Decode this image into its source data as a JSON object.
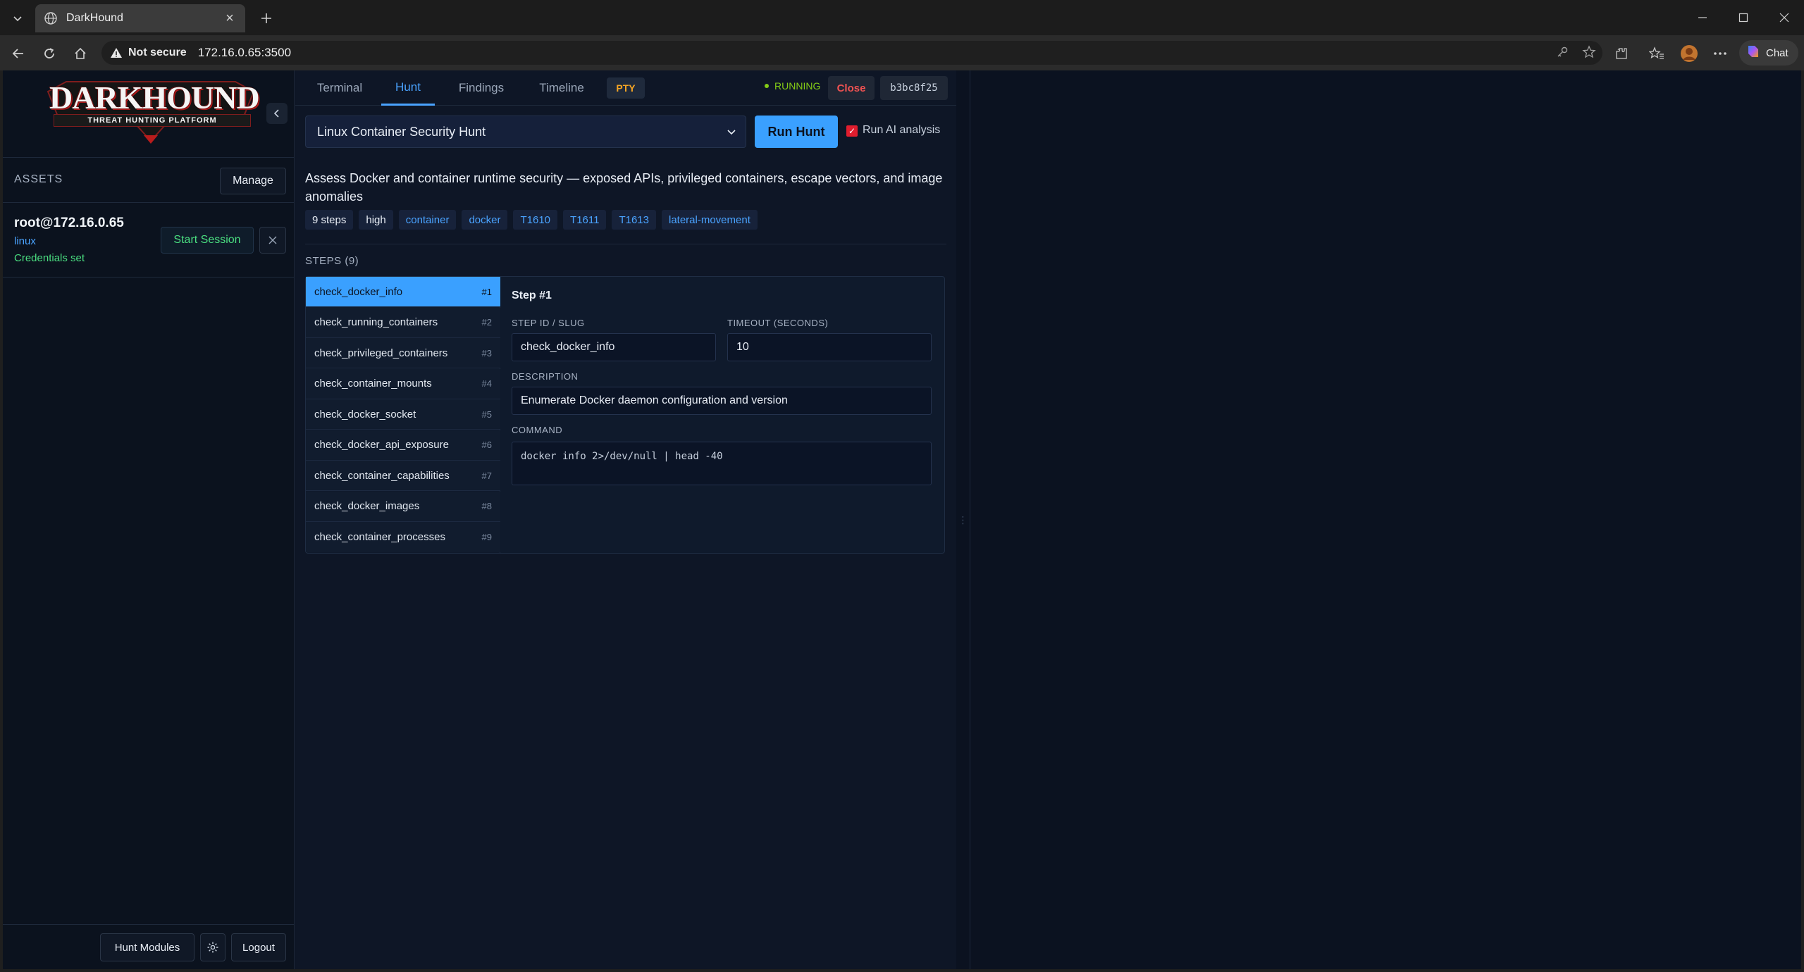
{
  "browser": {
    "tab_title": "DarkHound",
    "omnibox_warning": "Not secure",
    "url": "172.16.0.65:3500",
    "chat_label": "Chat"
  },
  "sidebar": {
    "logo_word": "DARKHOUND",
    "logo_sub": "THREAT HUNTING PLATFORM",
    "assets_title": "ASSETS",
    "manage_label": "Manage",
    "asset": {
      "host": "root@172.16.0.65",
      "os": "linux",
      "cred_status": "Credentials set",
      "start_label": "Start Session"
    },
    "footer": {
      "hunt_modules_label": "Hunt Modules",
      "logout_label": "Logout"
    }
  },
  "main": {
    "tabs": [
      {
        "label": "Terminal"
      },
      {
        "label": "Hunt"
      },
      {
        "label": "Findings"
      },
      {
        "label": "Timeline"
      }
    ],
    "active_tab": "Hunt",
    "pty_label": "PTY",
    "status": "RUNNING",
    "close_label": "Close",
    "session_id": "b3bc8f25",
    "hunt_selected": "Linux Container Security Hunt",
    "run_label": "Run Hunt",
    "ai_label": "Run AI analysis",
    "ai_checked": true,
    "description": "Assess Docker and container runtime security — exposed APIs, privileged containers, escape vectors, and image anomalies",
    "tags_plain": [
      "9 steps",
      "high"
    ],
    "tags_blue": [
      "container",
      "docker",
      "T1610",
      "T1611",
      "T1613",
      "lateral-movement"
    ],
    "steps_label": "STEPS (9)",
    "steps": [
      {
        "slug": "check_docker_info",
        "num": "#1"
      },
      {
        "slug": "check_running_containers",
        "num": "#2"
      },
      {
        "slug": "check_privileged_containers",
        "num": "#3"
      },
      {
        "slug": "check_container_mounts",
        "num": "#4"
      },
      {
        "slug": "check_docker_socket",
        "num": "#5"
      },
      {
        "slug": "check_docker_api_exposure",
        "num": "#6"
      },
      {
        "slug": "check_container_capabilities",
        "num": "#7"
      },
      {
        "slug": "check_docker_images",
        "num": "#8"
      },
      {
        "slug": "check_container_processes",
        "num": "#9"
      }
    ],
    "editor": {
      "title": "Step #1",
      "slug_label": "STEP ID / SLUG",
      "slug_value": "check_docker_info",
      "timeout_label": "TIMEOUT (SECONDS)",
      "timeout_value": "10",
      "desc_label": "DESCRIPTION",
      "desc_value": "Enumerate Docker daemon configuration and version",
      "command_label": "COMMAND",
      "command_value": "docker info 2>/dev/null | head -40"
    }
  },
  "colors": {
    "accent": "#3aa0ff",
    "running": "#84cc16",
    "danger": "#f05252",
    "credentials": "#4ade80",
    "pty": "#f5a524"
  }
}
